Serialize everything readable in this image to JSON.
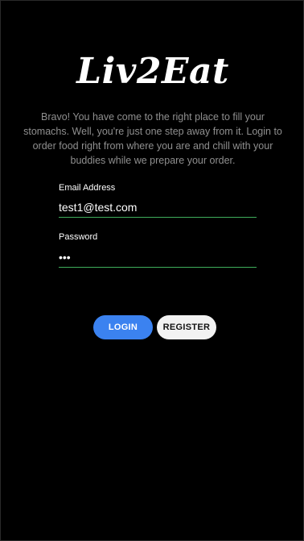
{
  "app": {
    "logo_text": "Liv2Eat",
    "intro_text": "Bravo! You have come to the right place to fill your stomachs. Well, you're just one step away from it. Login to order food right from where you are and chill with your buddies while we prepare your order."
  },
  "form": {
    "email": {
      "label": "Email Address",
      "value": "test1@test.com"
    },
    "password": {
      "label": "Password",
      "value": "•••"
    }
  },
  "actions": {
    "login_label": "LOGIN",
    "register_label": "REGISTER"
  },
  "colors": {
    "background": "#000000",
    "input_underline": "#3fae5b",
    "login_button": "#3b82f0",
    "register_button": "#f2f2f2",
    "intro_text": "#8f8f8f"
  }
}
